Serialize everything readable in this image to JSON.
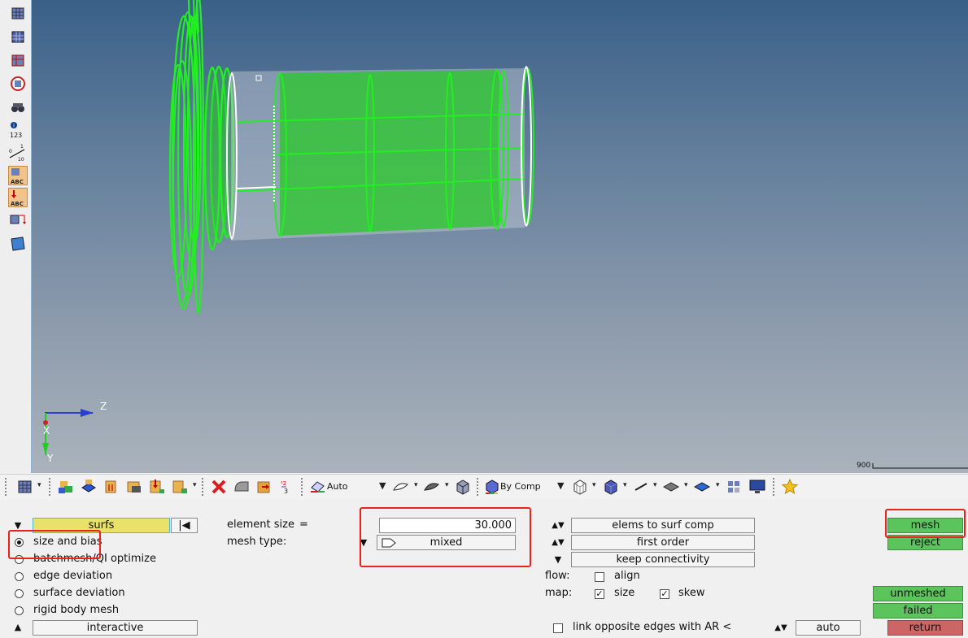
{
  "viewport": {
    "axis": {
      "z": "Z",
      "x": "X",
      "y": "Y"
    },
    "scale_label": "900"
  },
  "bottom_toolbar": {
    "mesh_mode": "Auto",
    "color_mode": "By Comp"
  },
  "panel": {
    "entity_selector": "surfs",
    "element_size_label": "element size",
    "equals": "=",
    "element_size_value": "30.000",
    "mesh_type_label": "mesh type:",
    "mesh_type_value": "mixed",
    "mode_options": [
      {
        "label": "size and bias",
        "selected": true
      },
      {
        "label": "batchmesh/QI optimize",
        "selected": false
      },
      {
        "label": "edge deviation",
        "selected": false
      },
      {
        "label": "surface deviation",
        "selected": false
      },
      {
        "label": "rigid body mesh",
        "selected": false
      }
    ],
    "interactive_label": "interactive",
    "elems_to_surf_comp": "elems to surf comp",
    "first_order": "first order",
    "keep_connectivity": "keep connectivity",
    "flow_label": "flow:",
    "align_label": "align",
    "map_label": "map:",
    "size_label": "size",
    "skew_label": "skew",
    "link_label": "link opposite edges with AR <",
    "auto_label": "auto",
    "mesh_button": "mesh",
    "reject_button": "reject",
    "unmeshed_button": "unmeshed",
    "failed_button": "failed",
    "return_button": "return"
  }
}
